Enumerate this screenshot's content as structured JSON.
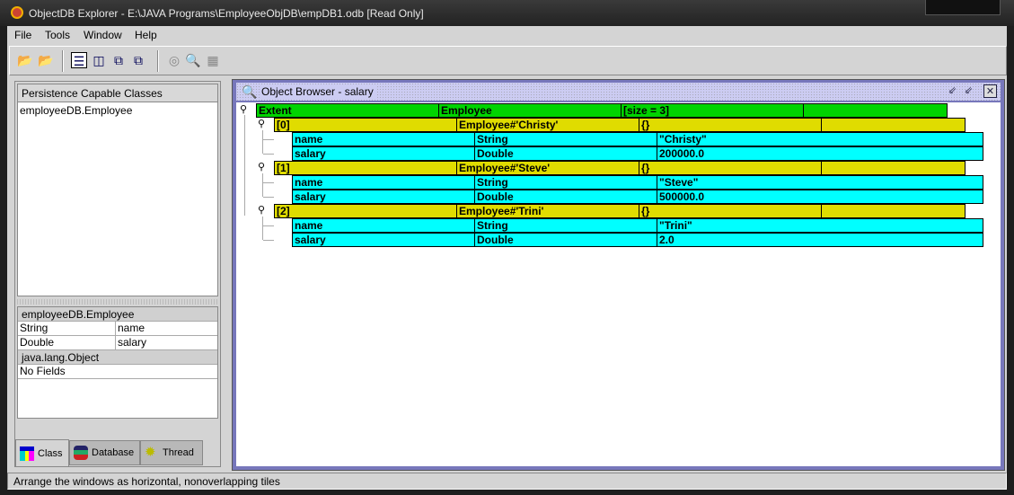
{
  "window": {
    "title": "ObjectDB Explorer - E:\\JAVA Programs\\EmployeeObjDB\\empDB1.odb [Read Only]"
  },
  "menu": [
    {
      "label": "File"
    },
    {
      "label": "Tools"
    },
    {
      "label": "Window"
    },
    {
      "label": "Help"
    }
  ],
  "toolbar": {
    "icons": [
      "open-folder-icon",
      "open-folder-readonly-icon",
      "tile-horizontal-icon",
      "tile-vertical-icon",
      "cascade-icon",
      "arrange-icon",
      "target-icon",
      "query-icon",
      "table-icon"
    ]
  },
  "left": {
    "classes_header": "Persistence Capable Classes",
    "classes": [
      "employeeDB.Employee"
    ],
    "fields": {
      "class_name": "employeeDB.Employee",
      "rows": [
        {
          "type": "String",
          "name": "name"
        },
        {
          "type": "Double",
          "name": "salary"
        }
      ],
      "super_name": "java.lang.Object",
      "super_rows": "No Fields"
    },
    "tabs": [
      {
        "label": "Class"
      },
      {
        "label": "Database"
      },
      {
        "label": "Thread"
      }
    ]
  },
  "browser": {
    "title": "Object Browser - salary",
    "extent": [
      "Extent",
      "Employee",
      "[size = 3]"
    ],
    "objects": [
      {
        "cols": [
          "[0]",
          "Employee#'Christy'",
          "{}"
        ],
        "fields": [
          [
            "name",
            "String",
            "\"Christy\""
          ],
          [
            "salary",
            "Double",
            "200000.0"
          ]
        ]
      },
      {
        "cols": [
          "[1]",
          "Employee#'Steve'",
          "{}"
        ],
        "fields": [
          [
            "name",
            "String",
            "\"Steve\""
          ],
          [
            "salary",
            "Double",
            "500000.0"
          ]
        ]
      },
      {
        "cols": [
          "[2]",
          "Employee#'Trini'",
          "{}"
        ],
        "fields": [
          [
            "name",
            "String",
            "\"Trini\""
          ],
          [
            "salary",
            "Double",
            "2.0"
          ]
        ]
      }
    ]
  },
  "status": "Arrange the windows as horizontal, nonoverlapping tiles"
}
